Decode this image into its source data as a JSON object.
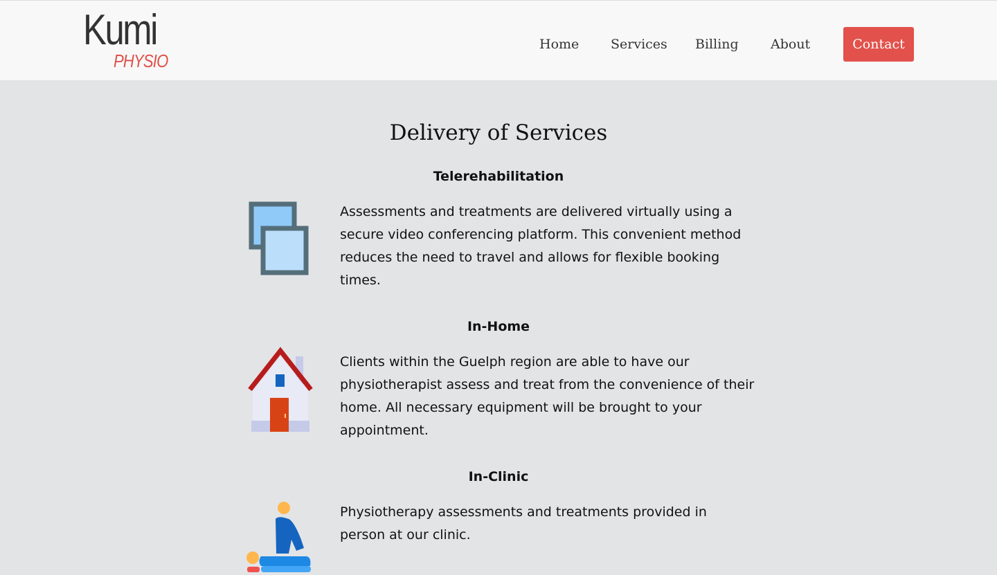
{
  "logo": {
    "main": "Kumi",
    "sub": "PHYSIO"
  },
  "nav": {
    "home": "Home",
    "services": "Services",
    "billing": "Billing",
    "about": "About",
    "contact": "Contact"
  },
  "page": {
    "title": "Delivery of Services"
  },
  "services": [
    {
      "title": "Telerehabilitation",
      "description": "Assessments and treatments are delivered virtually using a secure video conferencing platform. This convenient method reduces the need to travel and allows for flexible booking times.",
      "icon": "video-windows-icon"
    },
    {
      "title": "In-Home",
      "description": "Clients within the Guelph region are able to have our physiotherapist assess and treat from the convenience of their home. All necessary equipment will be brought to your appointment.",
      "icon": "house-icon"
    },
    {
      "title": "In-Clinic",
      "description": "Physiotherapy assessments and treatments provided in person at our clinic.",
      "icon": "physiotherapy-treatment-icon"
    }
  ],
  "colors": {
    "accent": "#e2514b",
    "background": "#e3e4e6",
    "header": "#f8f8f8"
  }
}
